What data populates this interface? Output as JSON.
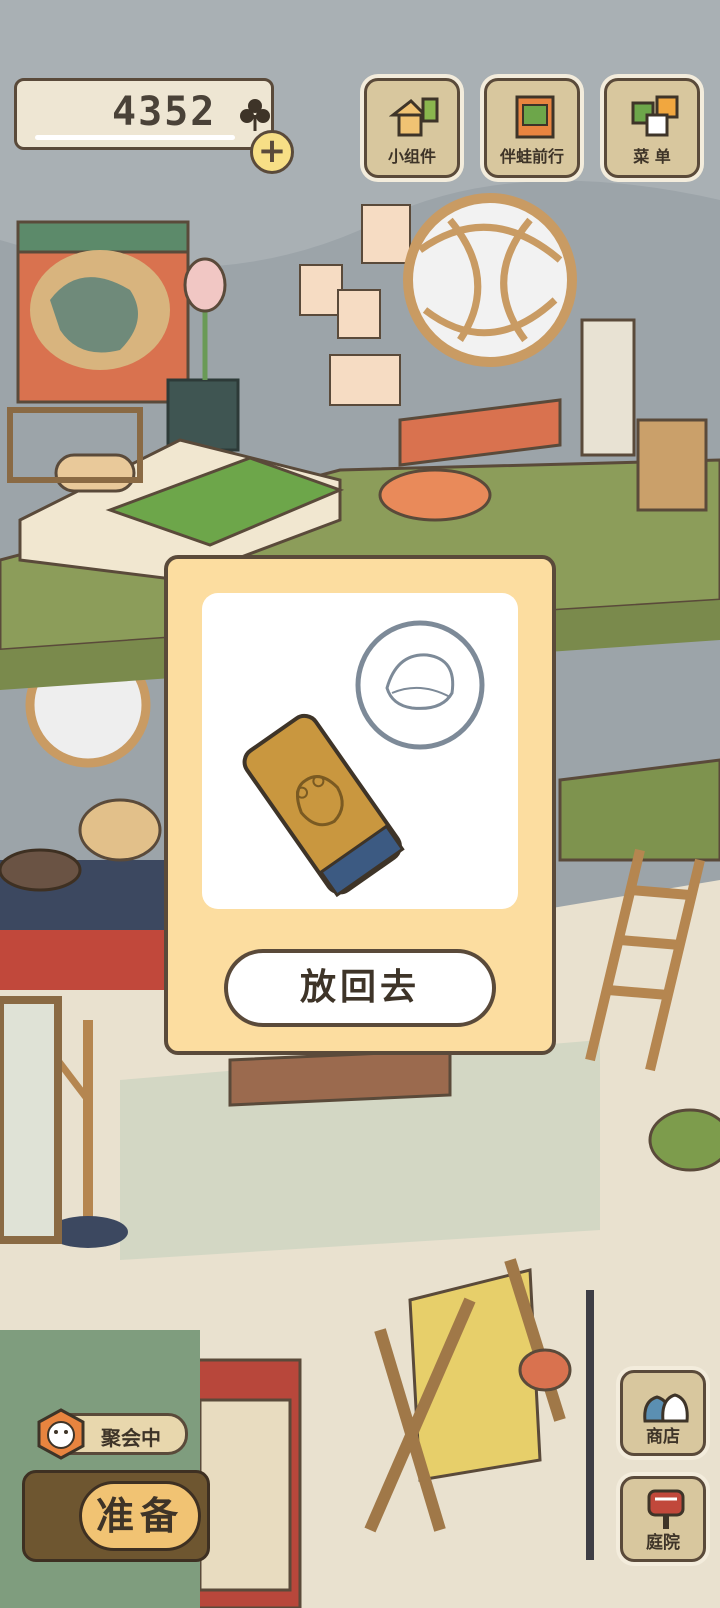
{
  "top_bar": {
    "clover_count": "4352",
    "clover_icon": "clover-icon",
    "add_icon": "plus-icon"
  },
  "menu": {
    "widgets_label": "小组件",
    "travel_label": "伴蛙前行",
    "menu_label": "菜 单"
  },
  "modal": {
    "item_name": "frog-stamp",
    "put_back_label": "放回去"
  },
  "bottom": {
    "party_label": "聚会中",
    "prepare_label": "准备",
    "shop_label": "商店",
    "yard_label": "庭院"
  },
  "colors": {
    "modal_bg": "#fcdda0",
    "outline": "#5a4a3a",
    "wall": "#9aa3a8",
    "floor": "#e9e1cf"
  }
}
